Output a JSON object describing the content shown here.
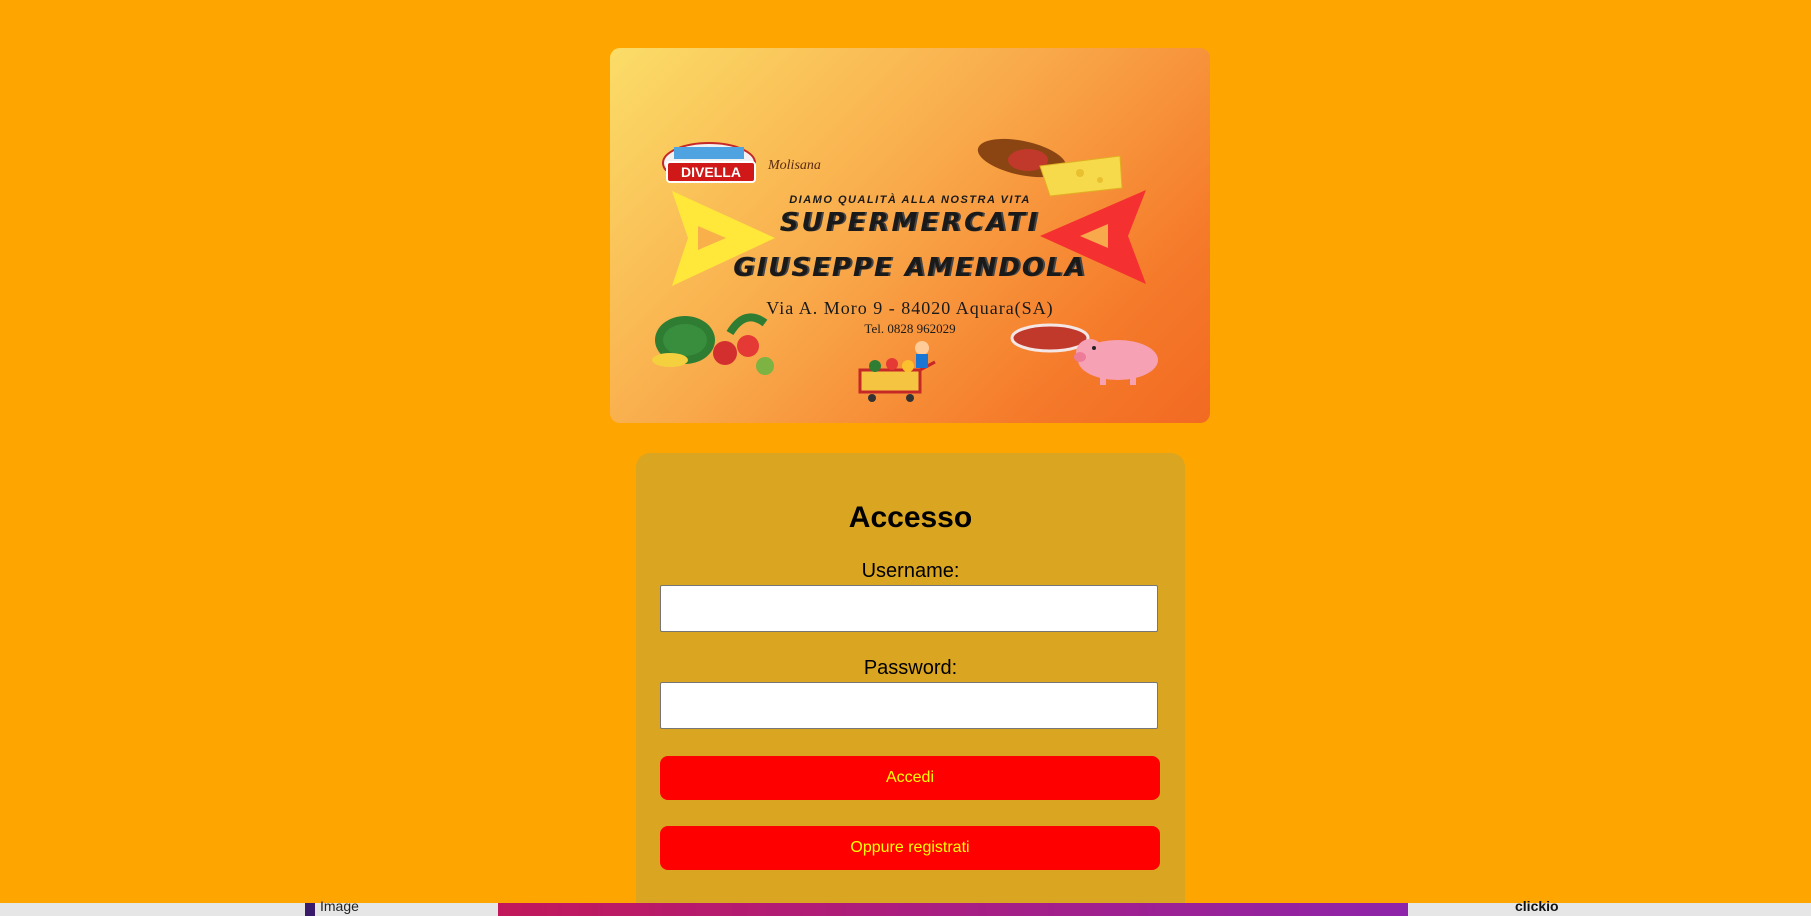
{
  "banner": {
    "logo_divella": "DIVELLA",
    "logo_molisana": "Molisana",
    "tagline": "DIAMO QUALITÀ ALLA NOSTRA VITA",
    "brand_line1": "SUPERMERCATI",
    "brand_line2": "GIUSEPPE AMENDOLA",
    "address": "Via A. Moro 9 - 84020 Aquara(SA)",
    "phone": "Tel. 0828 962029"
  },
  "login": {
    "title": "Accesso",
    "username_label": "Username:",
    "username_value": "",
    "password_label": "Password:",
    "password_value": "",
    "submit_label": "Accedi",
    "register_label": "Oppure registrati"
  },
  "bottom_strip": {
    "left_text": "Image",
    "right_text": "clickio"
  },
  "colors": {
    "page_background": "#FFA500",
    "card_background": "#DAA520",
    "button_background": "#FF0000",
    "button_text": "#FFFF00"
  }
}
